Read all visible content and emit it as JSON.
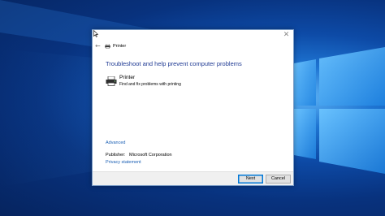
{
  "window": {
    "title": "Printer",
    "close_glyph": "✕",
    "back_glyph": "←"
  },
  "main": {
    "heading": "Troubleshoot and help prevent computer problems",
    "item": {
      "name": "Printer",
      "description": "Find and fix problems with printing",
      "icon": "printer-icon"
    }
  },
  "links": {
    "advanced": "Advanced",
    "privacy": "Privacy statement"
  },
  "publisher": {
    "label": "Publisher:",
    "value": "Microsoft Corporation"
  },
  "buttons": {
    "next": "Next",
    "cancel": "Cancel"
  },
  "colors": {
    "heading_blue": "#1f3a93",
    "link_blue": "#1a5fb4",
    "accent": "#0078d7",
    "desktop_blue": "#0d4aa6"
  }
}
